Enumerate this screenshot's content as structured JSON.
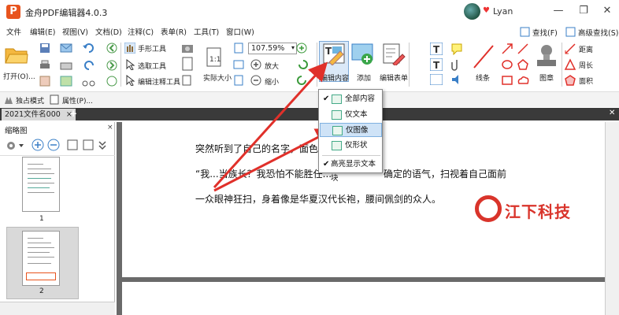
{
  "window": {
    "logo": "P",
    "title": "金舟PDF编辑器4.0.3",
    "username": "Lyan",
    "controls": {
      "minimize": "—",
      "restore": "❐",
      "close": "✕"
    }
  },
  "menu": [
    "文件",
    "编辑(E)",
    "视图(V)",
    "文档(D)",
    "注释(C)",
    "表单(R)",
    "工具(T)",
    "窗口(W)"
  ],
  "right_tools": {
    "find": "查找(F)",
    "advanced_find": "高级查找(S)"
  },
  "ribbon": {
    "open_label": "打开(O)...",
    "hand_tool": "手形工具",
    "select_tool": "选取工具",
    "edit_annotation_tool": "编辑注释工具",
    "actual_size": "实际大小",
    "zoom_value": "107.59%",
    "zoom_in": "放大",
    "zoom_out": "缩小",
    "edit_content": "编辑内容",
    "add": "添加",
    "edit_form": "编辑表单",
    "lines": "线条",
    "stamp": "图章",
    "distance": "距离",
    "perimeter": "周长",
    "area": "面积"
  },
  "bar2": {
    "exclusive_mode": "独占模式",
    "properties": "属性(P)..."
  },
  "tab": {
    "label": "2021文件名000",
    "close": "×",
    "add": "+",
    "right_close": "✕"
  },
  "sidebar": {
    "title": "缩略图",
    "close": "×",
    "thumbnails": [
      {
        "number": "1"
      },
      {
        "number": "2"
      }
    ]
  },
  "document": {
    "lines": [
      "突然听到了自己的名字，面色有些",
      "“我...当族长？我恐怕不能胜任...",
      "确定的语气，扫视着自己面前",
      "一众眼神狂扫，身着像是华夏汉代长袍，腰间佩剑的众人。"
    ]
  },
  "dropdown": {
    "items": [
      {
        "label": "全部内容",
        "checked": true,
        "highlighted": false
      },
      {
        "label": "仅文本",
        "checked": false,
        "highlighted": false
      },
      {
        "label": "仅图像",
        "checked": false,
        "highlighted": true
      },
      {
        "label": "仅形状",
        "checked": false,
        "highlighted": false
      },
      {
        "label": "高亮显示文本块",
        "checked": true,
        "highlighted": false
      }
    ]
  },
  "watermark": {
    "text": "江下科技"
  },
  "colors": {
    "accent": "#e8541e",
    "arrow": "#e0302a",
    "highlight": "#cfe3f7"
  }
}
